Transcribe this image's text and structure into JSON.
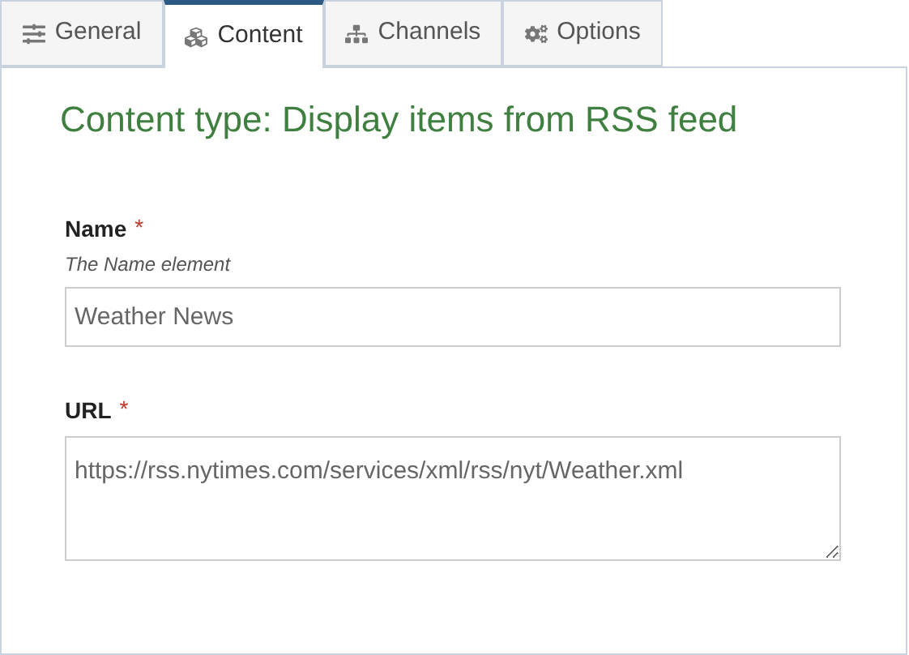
{
  "tabs": [
    {
      "label": "General",
      "selected": false
    },
    {
      "label": "Content",
      "selected": true
    },
    {
      "label": "Channels",
      "selected": false
    },
    {
      "label": "Options",
      "selected": false
    }
  ],
  "panel": {
    "title": "Content type: Display items from RSS feed",
    "fields": [
      {
        "kind": "input",
        "label": "Name",
        "required_mark": "*",
        "hint": "The Name element",
        "value": "Weather News"
      },
      {
        "kind": "textarea",
        "label": "URL",
        "required_mark": "*",
        "value": "https://rss.nytimes.com/services/xml/rss/nyt/Weather.xml"
      }
    ]
  }
}
